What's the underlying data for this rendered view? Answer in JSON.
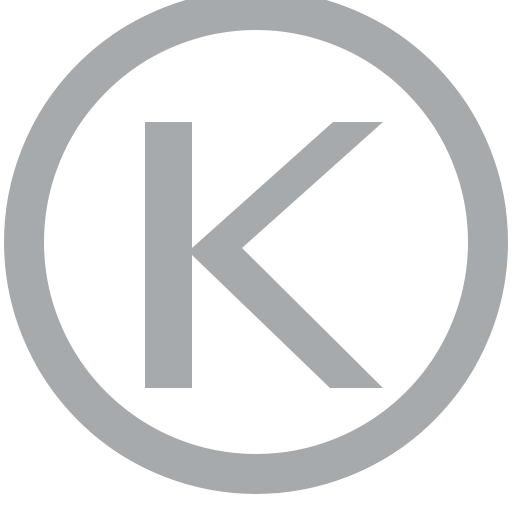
{
  "emblem": {
    "icon": "circled-letter-k-icon",
    "letter": "K",
    "color": "#a7aaac",
    "background": "#ffffff"
  }
}
